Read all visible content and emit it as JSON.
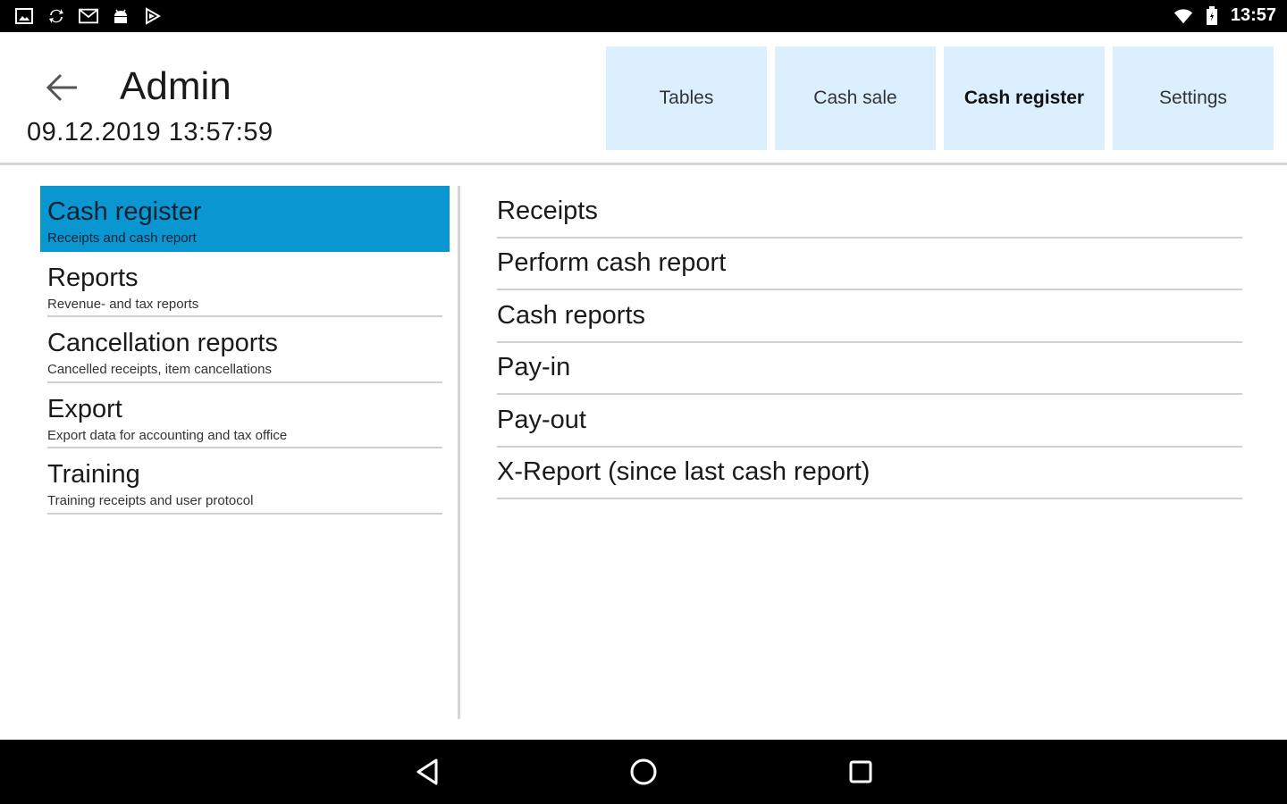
{
  "status_bar": {
    "left_icons": [
      "image-icon",
      "sync-icon",
      "mail-icon",
      "android-icon",
      "play-store-icon"
    ],
    "right_icons": [
      "wifi-icon",
      "battery-icon"
    ],
    "time": "13:57"
  },
  "header": {
    "user_name": "Admin",
    "datetime": "09.12.2019 13:57:59"
  },
  "nav_tabs": [
    {
      "label": "Tables",
      "active": false
    },
    {
      "label": "Cash sale",
      "active": false
    },
    {
      "label": "Cash register",
      "active": true
    },
    {
      "label": "Settings",
      "active": false
    }
  ],
  "left_menu": {
    "items": [
      {
        "title": "Cash register",
        "subtitle": "Receipts and cash report",
        "active": true
      },
      {
        "title": "Reports",
        "subtitle": "Revenue- and tax reports",
        "active": false
      },
      {
        "title": "Cancellation reports",
        "subtitle": "Cancelled receipts, item cancellations",
        "active": false
      },
      {
        "title": "Export",
        "subtitle": "Export data for accounting and tax office",
        "active": false
      },
      {
        "title": "Training",
        "subtitle": "Training receipts and user protocol",
        "active": false
      }
    ]
  },
  "right_list": {
    "items": [
      "Receipts",
      "Perform cash report",
      "Cash reports",
      "Pay-in",
      "Pay-out",
      "X-Report (since last cash report)"
    ]
  },
  "nav_bar": {
    "buttons": [
      "back-nav-icon",
      "home-nav-icon",
      "recents-nav-icon"
    ]
  },
  "colors": {
    "accent": "#0a96d0",
    "tab_background": "#dcefff",
    "divider": "#d0d0d0",
    "system_bar": "#000000"
  }
}
